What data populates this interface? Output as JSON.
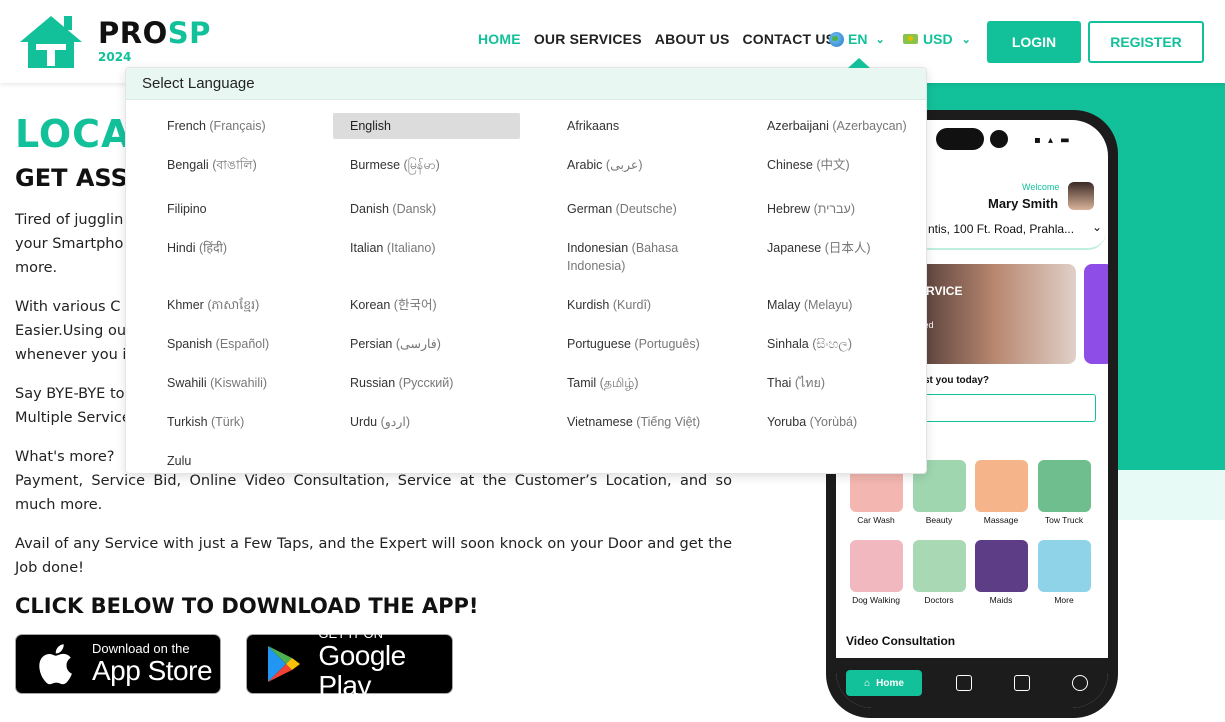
{
  "brand": {
    "name_dark": "PRO",
    "name_green": "SP",
    "year": "2024"
  },
  "nav": {
    "items": [
      {
        "label": "HOME",
        "active": true
      },
      {
        "label": "OUR SERVICES",
        "active": false
      },
      {
        "label": "ABOUT US",
        "active": false
      },
      {
        "label": "CONTACT US",
        "active": false
      }
    ],
    "language": "EN",
    "currency": "USD",
    "login_label": "LOGIN",
    "register_label": "REGISTER"
  },
  "hero": {
    "title_visible": "LOCA",
    "subtitle_visible": "GET ASSI",
    "paragraphs": [
      {
        "lines": [
          "Tired of jugglin",
          "your Smartpho",
          "more."
        ]
      },
      {
        "lines": [
          "With various C",
          "Easier.Using ou",
          "whenever you i"
        ]
      },
      {
        "lines": [
          "Say BYE-BYE to",
          "Multiple Service"
        ]
      },
      {
        "text": "What's more?",
        "continuation": "Payment, Service Bid, Online Video Consultation, Service at the Customer’s Location, and so much more."
      },
      {
        "text": "Avail of any Service with just a Few Taps, and the Expert will soon knock on your Door and get the Job done!"
      }
    ],
    "cta": "CLICK BELOW TO DOWNLOAD THE APP!"
  },
  "stores": {
    "apple": {
      "small": "Download on the",
      "big": "App Store"
    },
    "google": {
      "small": "GET IT ON",
      "big": "Google Play"
    }
  },
  "phone": {
    "welcome": "Welcome",
    "user": "Mary Smith",
    "address": "ntis, 100 Ft. Road, Prahla...",
    "banner_title": "N SERVICE",
    "banner_sub_1": "in",
    "banner_sub_2": "ampered",
    "question": "st you today?",
    "services": [
      {
        "label": "Car Wash",
        "color": "#f4b6b0"
      },
      {
        "label": "Beauty",
        "color": "#9fd6b0"
      },
      {
        "label": "Massage",
        "color": "#f6b48a"
      },
      {
        "label": "Tow Truck",
        "color": "#6fbf8e"
      },
      {
        "label": "Dog Walking",
        "color": "#f2b8bf"
      },
      {
        "label": "Doctors",
        "color": "#a9d9b4"
      },
      {
        "label": "Maids",
        "color": "#5c3d86"
      },
      {
        "label": "More",
        "color": "#8fd3e8"
      }
    ],
    "video_consultation": "Video Consultation",
    "home_tab": "Home"
  },
  "language_dropdown": {
    "header": "Select Language",
    "selected": "English",
    "languages": [
      {
        "name": "French",
        "native": "(Français)"
      },
      {
        "name": "English",
        "native": ""
      },
      {
        "name": "Afrikaans",
        "native": ""
      },
      {
        "name": "Azerbaijani",
        "native": "(Azerbaycan)"
      },
      {
        "name": "Bengali",
        "native": "(বাঙালি)"
      },
      {
        "name": "Burmese",
        "native": "(မြန်မာ)"
      },
      {
        "name": "Arabic",
        "native": "(عربى)"
      },
      {
        "name": "Chinese",
        "native": "(中文)"
      },
      {
        "name": "Filipino",
        "native": ""
      },
      {
        "name": "Danish",
        "native": "(Dansk)"
      },
      {
        "name": "German",
        "native": "(Deutsche)"
      },
      {
        "name": "Hebrew",
        "native": "(עברית)"
      },
      {
        "name": "Hindi",
        "native": "(हिंदी)"
      },
      {
        "name": "Italian",
        "native": "(Italiano)"
      },
      {
        "name": "Indonesian",
        "native": "(Bahasa Indonesia)"
      },
      {
        "name": "Japanese",
        "native": "(日本人)"
      },
      {
        "name": "Khmer",
        "native": "(ភាសាខ្មែរ)"
      },
      {
        "name": "Korean",
        "native": "(한국어)"
      },
      {
        "name": "Kurdish",
        "native": "(Kurdî)"
      },
      {
        "name": "Malay",
        "native": "(Melayu)"
      },
      {
        "name": "Spanish",
        "native": "(Español)"
      },
      {
        "name": "Persian",
        "native": "(فارسی)"
      },
      {
        "name": "Portuguese",
        "native": "(Português)"
      },
      {
        "name": "Sinhala",
        "native": "(සිංහල)"
      },
      {
        "name": "Swahili",
        "native": "(Kiswahili)"
      },
      {
        "name": "Russian",
        "native": "(Русский)"
      },
      {
        "name": "Tamil",
        "native": "(தமிழ்)"
      },
      {
        "name": "Thai",
        "native": "(ไทย)"
      },
      {
        "name": "Turkish",
        "native": "(Türk)"
      },
      {
        "name": "Urdu",
        "native": "(اردو)"
      },
      {
        "name": "Vietnamese",
        "native": "(Tiếng Việt)"
      },
      {
        "name": "Yoruba",
        "native": "(Yorùbá)"
      },
      {
        "name": "Zulu",
        "native": ""
      }
    ]
  },
  "colors": {
    "accent": "#12c19a",
    "dropdown_header_bg": "#e9f7f3"
  }
}
